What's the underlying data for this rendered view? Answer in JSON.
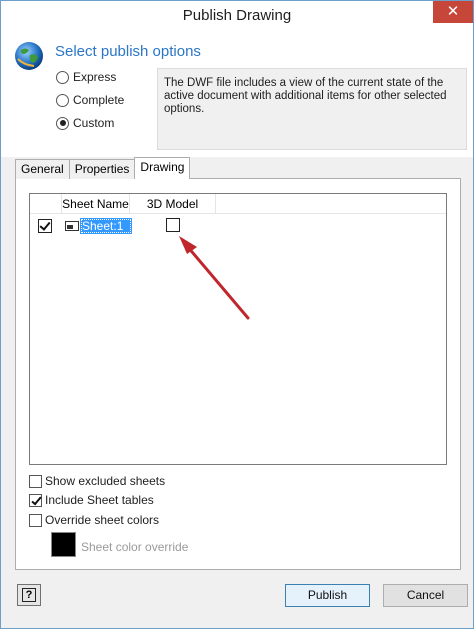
{
  "window": {
    "title": "Publish Drawing",
    "close_glyph": "✕"
  },
  "header": {
    "heading": "Select publish options",
    "icon": "globe-icon"
  },
  "publish_options": [
    {
      "label": "Express",
      "checked": false
    },
    {
      "label": "Complete",
      "checked": false
    },
    {
      "label": "Custom",
      "checked": true
    }
  ],
  "description": "The DWF file includes a view of the current state of the active document with additional items for other selected options.",
  "tabs": [
    {
      "label": "General",
      "active": false
    },
    {
      "label": "Properties",
      "active": false
    },
    {
      "label": "Drawing",
      "active": true
    }
  ],
  "sheet_table": {
    "columns": [
      "",
      "Sheet Name",
      "3D Model"
    ],
    "rows": [
      {
        "included": true,
        "sheet_name": "Sheet:1",
        "model_3d": false
      }
    ]
  },
  "options": {
    "show_excluded": {
      "label": "Show excluded sheets",
      "checked": false
    },
    "include_tables": {
      "label": "Include Sheet tables",
      "checked": true
    },
    "override_colors": {
      "label": "Override sheet colors",
      "checked": false
    },
    "color_override_label": "Sheet color override",
    "swatch_color": "#000000"
  },
  "footer": {
    "help_glyph": "?",
    "publish_label": "Publish",
    "cancel_label": "Cancel"
  },
  "annotation": {
    "arrow_color": "#c0272d"
  }
}
